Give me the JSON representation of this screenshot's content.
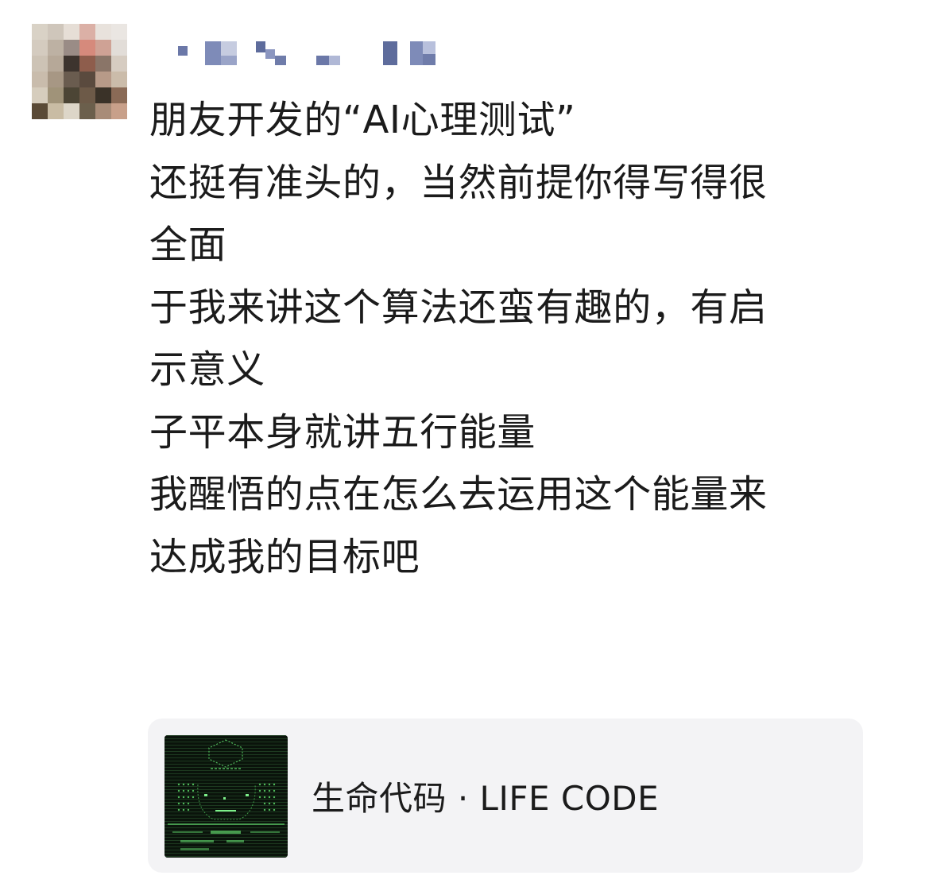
{
  "post": {
    "author_name": "",
    "lines": [
      "朋友开发的“AI心理测试”",
      "还挺有准头的，当然前提你得写得很",
      "全面",
      "于我来讲这个算法还蛮有趣的，有启",
      "示意义",
      "子平本身就讲五行能量",
      "我醒悟的点在怎么去运用这个能量来",
      "达成我的目标吧"
    ]
  },
  "link_card": {
    "title": "生命代码 · LIFE CODE",
    "thumbnail_icon": "terminal-face-icon"
  },
  "colors": {
    "text": "#1b1b1b",
    "card_bg": "#f3f3f5",
    "thumb_bg": "#0a130b",
    "thumb_green": "#5fd36a"
  }
}
